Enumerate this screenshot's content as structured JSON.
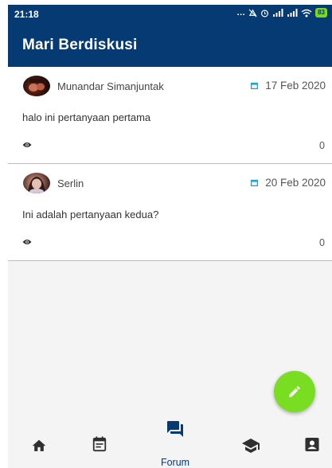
{
  "status_bar": {
    "time": "21:18",
    "battery": "83"
  },
  "app_bar": {
    "title": "Mari Berdiskusi"
  },
  "posts": [
    {
      "author": "Munandar Simanjuntak",
      "date": "17 Feb 2020",
      "text": "halo ini pertanyaan pertama",
      "views": "0"
    },
    {
      "author": "Serlin",
      "date": "20 Feb 2020",
      "text": "Ini adalah pertanyaan kedua?",
      "views": "0"
    }
  ],
  "bottom_nav": {
    "active_label": "Forum",
    "items": [
      "home-icon",
      "calendar-icon",
      "forum-icon",
      "school-icon",
      "account-box-icon"
    ]
  },
  "colors": {
    "primary": "#063a73",
    "accent": "#79de22",
    "date_icon": "#1ba6d8",
    "divider": "#9be34d"
  }
}
